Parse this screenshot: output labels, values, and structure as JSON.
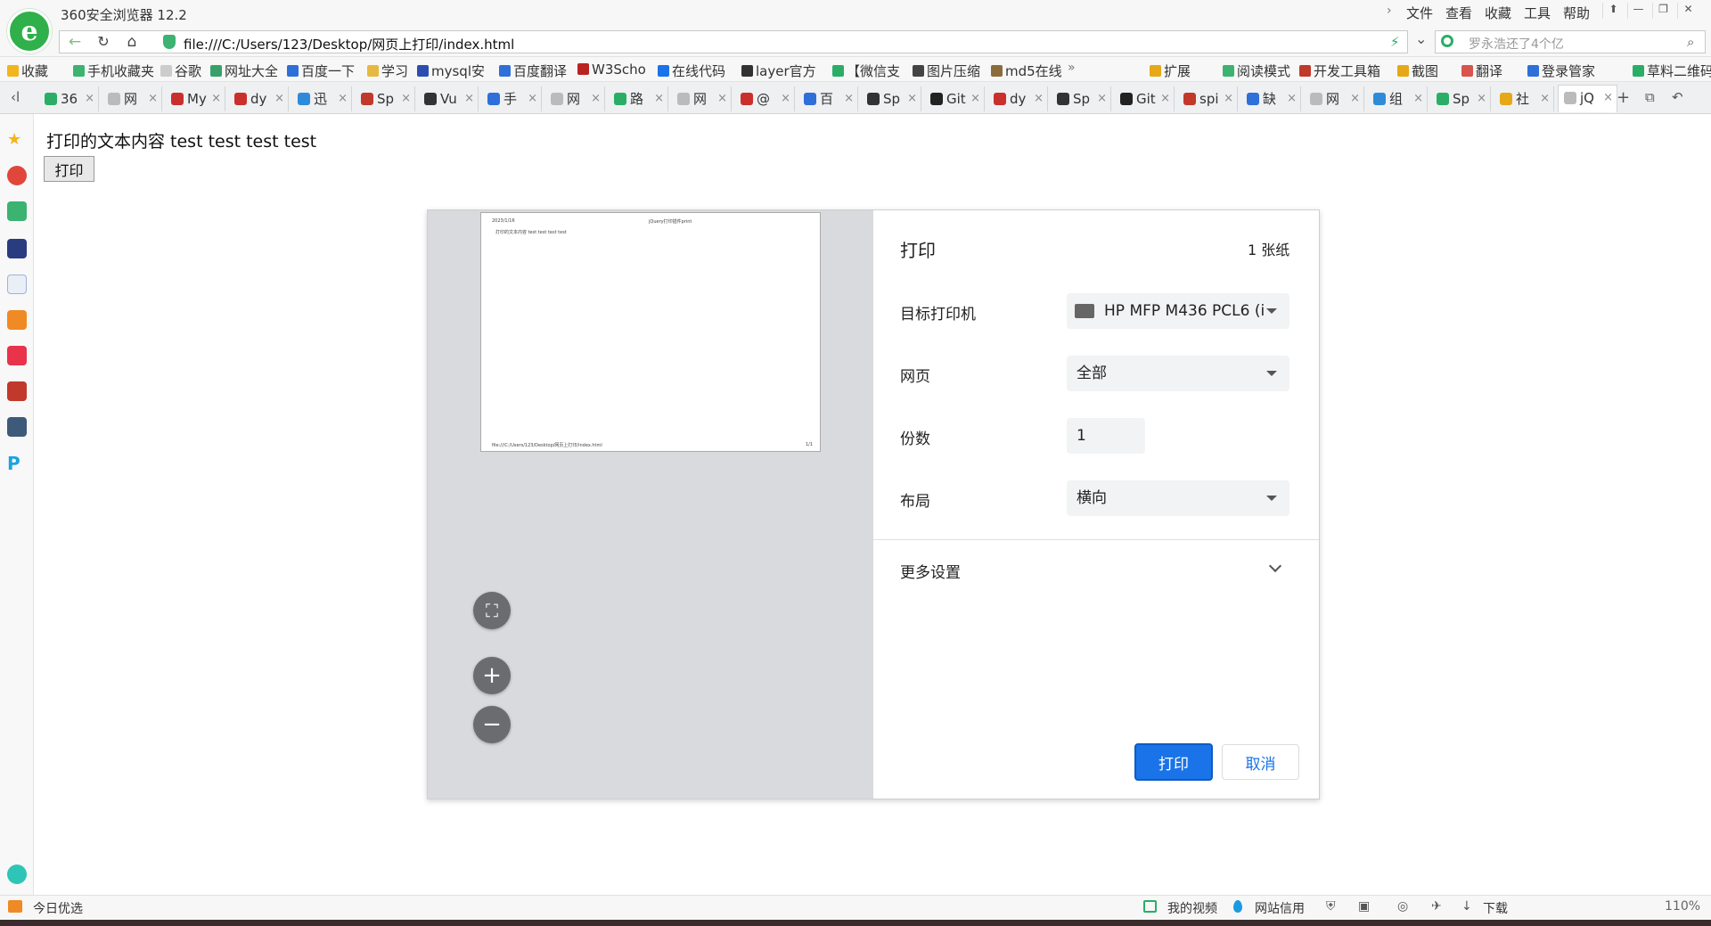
{
  "app": {
    "title": "360安全浏览器 12.2",
    "logo_letter": "e",
    "menu": [
      "文件",
      "查看",
      "收藏",
      "工具",
      "帮助"
    ],
    "window_buttons": [
      "⬆",
      "—",
      "❐",
      "✕"
    ]
  },
  "nav": {
    "url": "file:///C:/Users/123/Desktop/网页上打印/index.html",
    "search_placeholder": "罗永浩还了4个亿",
    "lightning_icon": "⚡",
    "dropdown_icon": "⌄"
  },
  "bookmarks": {
    "items": [
      {
        "label": "收藏",
        "color": "#f2b51c"
      },
      {
        "label": "手机收藏夹",
        "color": "#3cb371"
      },
      {
        "label": "谷歌",
        "color": "#cccccc"
      },
      {
        "label": "网址大全",
        "color": "#38a169"
      },
      {
        "label": "百度一下",
        "color": "#2e6fd9"
      },
      {
        "label": "学习",
        "color": "#e8b940"
      },
      {
        "label": "mysql安",
        "color": "#2a4fb0"
      },
      {
        "label": "百度翻译",
        "color": "#2e6fd9"
      },
      {
        "label": "W3Scho",
        "color": "#b22"
      },
      {
        "label": "在线代码",
        "color": "#1a73e8"
      },
      {
        "label": "layer官方",
        "color": "#333"
      },
      {
        "label": "【微信支",
        "color": "#2aae67"
      },
      {
        "label": "图片压缩",
        "color": "#444"
      },
      {
        "label": "md5在线",
        "color": "#8a6d3b"
      },
      {
        "label": "扩展",
        "color": "#e6a817"
      },
      {
        "label": "阅读模式",
        "color": "#3cb371"
      },
      {
        "label": "开发工具箱",
        "color": "#c0392b"
      },
      {
        "label": "截图",
        "color": "#e6a817"
      },
      {
        "label": "翻译",
        "color": "#d9534f"
      },
      {
        "label": "登录管家",
        "color": "#2e6fd9"
      },
      {
        "label": "草料二维码",
        "color": "#2aae67"
      }
    ]
  },
  "tabs": [
    {
      "label": "36",
      "color": "#2aae67"
    },
    {
      "label": "网",
      "color": "#bbbbbb"
    },
    {
      "label": "My",
      "color": "#c9302c"
    },
    {
      "label": "dy",
      "color": "#c9302c"
    },
    {
      "label": "迅",
      "color": "#2e8bd9"
    },
    {
      "label": "Sp",
      "color": "#c0392b"
    },
    {
      "label": "Vu",
      "color": "#333"
    },
    {
      "label": "手",
      "color": "#2e6fd9"
    },
    {
      "label": "网",
      "color": "#bbbbbb"
    },
    {
      "label": "路",
      "color": "#2aae67"
    },
    {
      "label": "网",
      "color": "#bbbbbb"
    },
    {
      "label": "@",
      "color": "#c9302c"
    },
    {
      "label": "百",
      "color": "#2e6fd9"
    },
    {
      "label": "Sp",
      "color": "#333"
    },
    {
      "label": "Git",
      "color": "#222"
    },
    {
      "label": "dy",
      "color": "#c9302c"
    },
    {
      "label": "Sp",
      "color": "#333"
    },
    {
      "label": "Git",
      "color": "#222"
    },
    {
      "label": "spi",
      "color": "#c0392b"
    },
    {
      "label": "缺",
      "color": "#2e6fd9"
    },
    {
      "label": "网",
      "color": "#bbbbbb"
    },
    {
      "label": "组",
      "color": "#2e8bd9"
    },
    {
      "label": "Sp",
      "color": "#2aae67"
    },
    {
      "label": "社",
      "color": "#e6a817"
    },
    {
      "label": "jQ",
      "color": "#bbbbbb"
    }
  ],
  "page": {
    "text": "打印的文本内容 test test test test",
    "print_button": "打印"
  },
  "print_dialog": {
    "title": "打印",
    "sheet_count": "1 张纸",
    "fields": {
      "printer_label": "目标打印机",
      "printer_value": "HP MFP M436 PCL6 (i",
      "pages_label": "网页",
      "pages_value": "全部",
      "copies_label": "份数",
      "copies_value": "1",
      "layout_label": "布局",
      "layout_value": "横向"
    },
    "more_settings": "更多设置",
    "print_button": "打印",
    "cancel_button": "取消",
    "preview": {
      "header_left": "2023/1/16",
      "header_center": "jQuery打印插件print",
      "body_text": "打印的文本内容 test test test test",
      "footer_left": "file:///C:/Users/123/Desktop/网页上打印/index.html",
      "footer_right": "1/1"
    },
    "zoom_buttons": {
      "fit": "⛶",
      "zoom_in": "+",
      "zoom_out": "−"
    }
  },
  "statusbar": {
    "left": "今日优选",
    "items": [
      "我的视频",
      "网站信用",
      "下载"
    ],
    "zoom": "110%"
  }
}
